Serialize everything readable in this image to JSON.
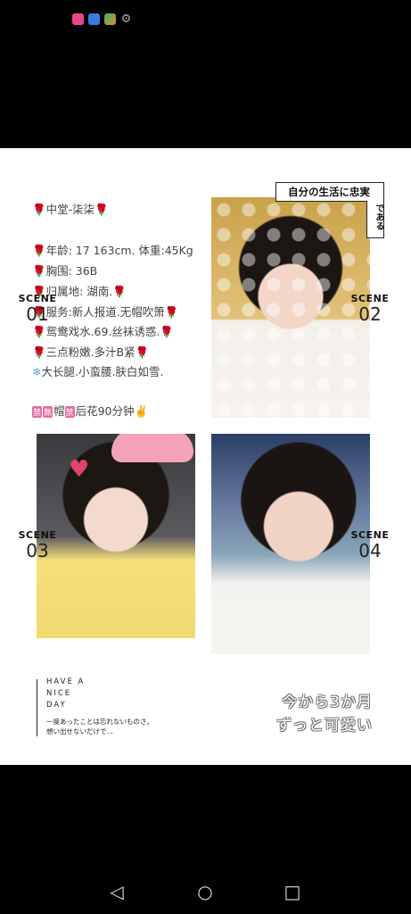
{
  "status_bar": {
    "icons": [
      "video-app-icon",
      "browser-app-icon",
      "store-app-icon",
      "settings-gear-icon"
    ],
    "gear_glyph": "⚙"
  },
  "bio": {
    "rose": "🌹",
    "snow": "❄",
    "line1": "中堂-柒柒",
    "line2": "年龄: 17  163cm.  体重:45Kg",
    "line3": "胸围: 36B",
    "line4": "归属地: 湖南.",
    "line5": "服务:新人报道.无帽吹箫",
    "line6": "鸳鸯戏水.69.丝袜诱惑.",
    "line7": "三点粉嫩.多汁B紧",
    "line8": "大长腿.小蛮腰.肤白如雪.",
    "tag1": "禁",
    "tag2": "無",
    "tag3": "禁",
    "line9a": "帽",
    "line9b": "后花90分钟✌️"
  },
  "stamp": {
    "horizontal": "自分の生活に忠実",
    "vertical": "である"
  },
  "scenes": [
    {
      "label": "SCENE",
      "number": "01"
    },
    {
      "label": "SCENE",
      "number": "02"
    },
    {
      "label": "SCENE",
      "number": "03"
    },
    {
      "label": "SCENE",
      "number": "04"
    }
  ],
  "photos": [
    "portrait-photo-1",
    "portrait-photo-2",
    "portrait-photo-3"
  ],
  "handwriting": {
    "line1": "HAVE A",
    "line2": "NICE",
    "line3": "DAY",
    "line4": "一度あったことは忘れないものさ。",
    "line5": "想い出せないだけで…"
  },
  "japanese_caption": {
    "line1": "今から3か月",
    "line2": "ずっと可愛い"
  },
  "navbar": {
    "back_glyph": "◁",
    "home_glyph": "○",
    "recent_glyph": "□"
  },
  "colors": {
    "background": "#000000",
    "card": "#ffffff",
    "rose": "#d21f3c"
  }
}
